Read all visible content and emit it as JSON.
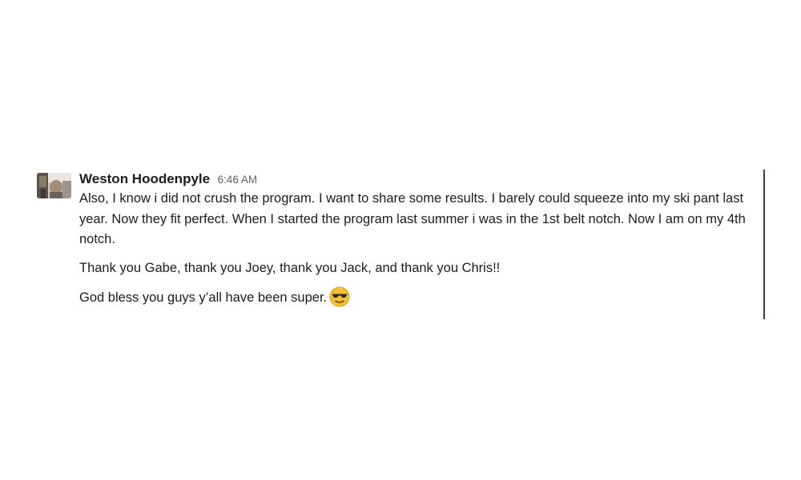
{
  "message": {
    "sender": "Weston Hoodenpyle",
    "timestamp": "6:46 AM",
    "paragraphs": [
      "Also, I know i did not crush the program. I want to share some results. I barely could squeeze into my ski pant last year. Now they fit perfect. When I started the program last summer i was in the 1st belt notch. Now I am on my 4th notch.",
      "Thank you Gabe, thank you Joey, thank you Jack, and thank you Chris!!",
      "God bless you guys y’all have been super."
    ],
    "emoji": "smiling-face-with-sunglasses-icon"
  },
  "colors": {
    "text": "#1d1c1d",
    "timestamp": "#616061",
    "emoji_face": "#f4c033",
    "emoji_glasses": "#2b2b2b"
  }
}
